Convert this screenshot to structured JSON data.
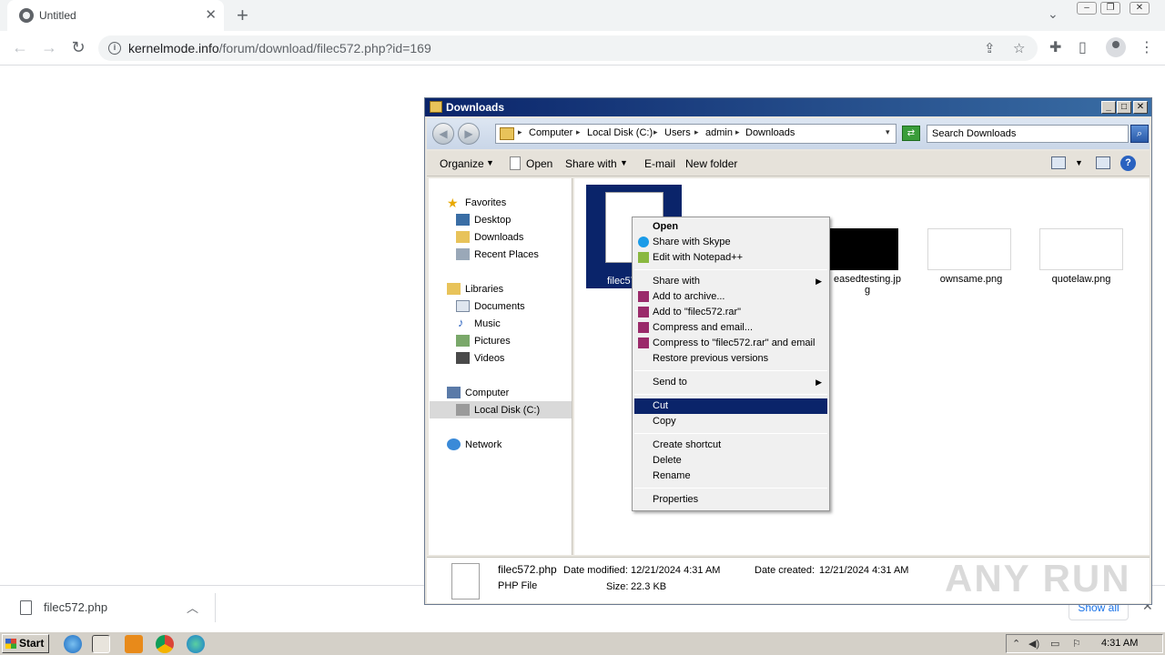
{
  "browser": {
    "tab": {
      "title": "Untitled",
      "close": "✕"
    },
    "new_tab": "+",
    "url": {
      "host": "kernelmode.info",
      "path": "/forum/download/filec572.php?id=169"
    },
    "icons": [
      "info-icon",
      "share-icon",
      "star-icon",
      "extensions-icon",
      "sidepanel-icon",
      "profile-icon",
      "menu-icon"
    ]
  },
  "download_shelf": {
    "file_name": "filec572.php",
    "show_all": "Show all"
  },
  "explorer": {
    "title": "Downloads",
    "breadcrumb": [
      "Computer",
      "Local Disk (C:)",
      "Users",
      "admin",
      "Downloads"
    ],
    "search_placeholder": "Search Downloads",
    "commands": {
      "organize": "Organize",
      "open": "Open",
      "share_with": "Share with",
      "email": "E-mail",
      "new_folder": "New folder"
    },
    "nav": {
      "favorites": "Favorites",
      "desktop": "Desktop",
      "downloads": "Downloads",
      "recent_places": "Recent Places",
      "libraries": "Libraries",
      "documents": "Documents",
      "music": "Music",
      "pictures": "Pictures",
      "videos": "Videos",
      "computer": "Computer",
      "local_disk": "Local Disk (C:)",
      "network": "Network"
    },
    "files": {
      "selected": "filec57",
      "jpg_line1": "easedtesting.jp",
      "jpg_line2": "g",
      "png1": "ownsame.png",
      "png2": "quotelaw.png"
    },
    "details": {
      "name": "filec572.php",
      "type": "PHP File",
      "date_modified_label": "Date modified:",
      "date_modified": "12/21/2024 4:31 AM",
      "date_created_label": "Date created:",
      "date_created": "12/21/2024 4:31 AM",
      "size_label": "Size:",
      "size": "22.3 KB"
    }
  },
  "context_menu": {
    "open": "Open",
    "share_skype": "Share with Skype",
    "edit_notepad": "Edit with Notepad++",
    "share_with": "Share with",
    "add_archive": "Add to archive...",
    "add_rar": "Add to \"filec572.rar\"",
    "compress_email": "Compress and email...",
    "compress_rar_email": "Compress to \"filec572.rar\" and email",
    "restore": "Restore previous versions",
    "send_to": "Send to",
    "cut": "Cut",
    "copy": "Copy",
    "create_shortcut": "Create shortcut",
    "delete": "Delete",
    "rename": "Rename",
    "properties": "Properties"
  },
  "watermark": "ANY RUN",
  "taskbar": {
    "start": "Start",
    "clock": "4:31 AM"
  }
}
